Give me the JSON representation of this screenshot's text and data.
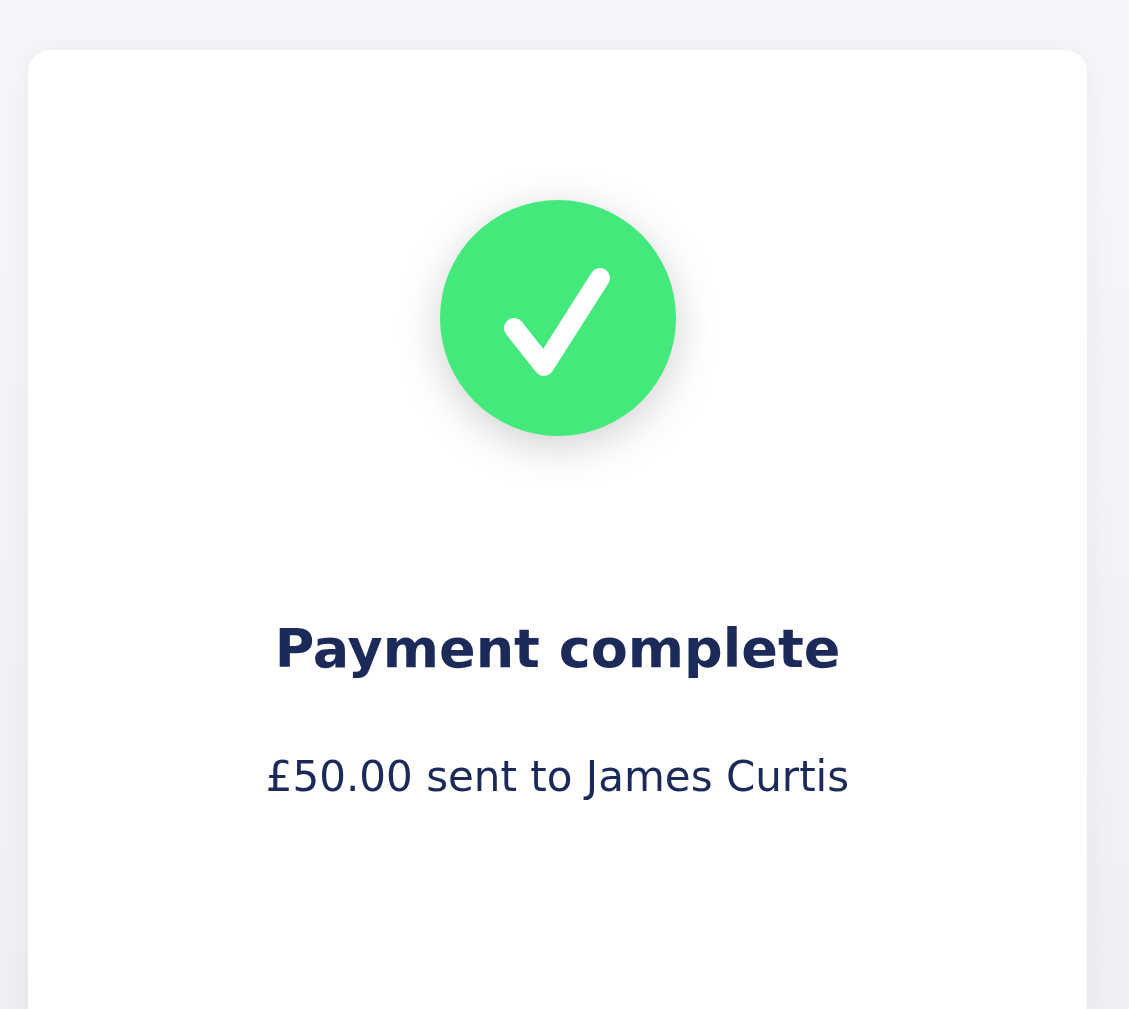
{
  "status": {
    "kind": "success"
  },
  "title": "Payment complete",
  "message": "£50.00 sent to James Curtis"
}
